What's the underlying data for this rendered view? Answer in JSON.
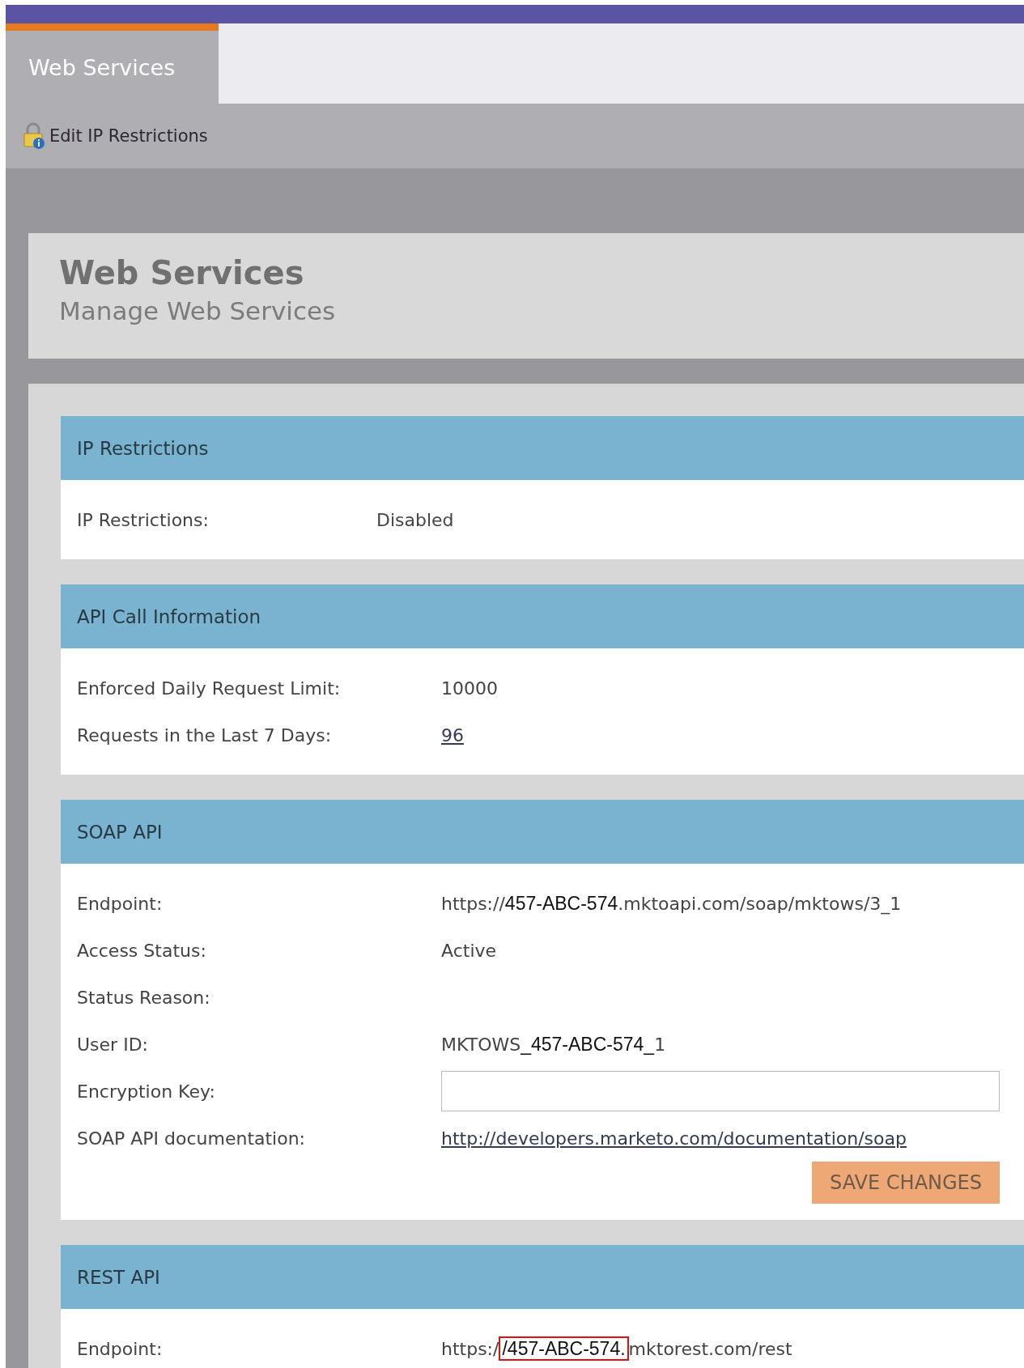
{
  "tabs": [
    {
      "label": "Web Services",
      "selected": true
    }
  ],
  "toolbar": [
    {
      "label": "Edit IP Restrictions"
    }
  ],
  "header": {
    "title": "Web Services",
    "subtitle": "Manage Web Services"
  },
  "sections": [
    {
      "title": "IP Restrictions",
      "narrow": true,
      "rows": [
        {
          "label": "IP Restrictions:",
          "kind": "text",
          "value": "Disabled"
        }
      ]
    },
    {
      "title": "API Call Information",
      "rows": [
        {
          "label": "Enforced Daily Request Limit:",
          "kind": "text",
          "value": "10000"
        },
        {
          "label": "Requests in the Last 7 Days:",
          "kind": "link",
          "value": "96"
        }
      ]
    },
    {
      "title": "SOAP API",
      "rows": [
        {
          "label": "Endpoint:",
          "kind": "segments",
          "segments": [
            {
              "text": "https://",
              "inserted": false,
              "highlighted": false
            },
            {
              "text": "457-ABC-574",
              "inserted": true,
              "highlighted": false
            },
            {
              "text": ".mktoapi.com/soap/mktows/3_1",
              "inserted": false,
              "highlighted": false
            }
          ]
        },
        {
          "label": "Access Status:",
          "kind": "text",
          "value": "Active"
        },
        {
          "label": "Status Reason:",
          "kind": "text"
        },
        {
          "label": "User ID:",
          "kind": "segments",
          "segments": [
            {
              "text": "MKTOWS",
              "inserted": false,
              "highlighted": false
            },
            {
              "text": "_457-ABC-574_",
              "inserted": true,
              "highlighted": false
            },
            {
              "text": "1",
              "inserted": false,
              "highlighted": false
            }
          ]
        },
        {
          "label": "Encryption Key:",
          "kind": "input"
        },
        {
          "label": "SOAP API documentation:",
          "kind": "link",
          "value": "http://developers.marketo.com/documentation/soap"
        }
      ],
      "button": {
        "label": "SAVE CHANGES",
        "disabled": true
      }
    },
    {
      "title": "REST API",
      "rows": [
        {
          "label": "Endpoint:",
          "kind": "segments",
          "segments": [
            {
              "text": "https:/",
              "inserted": false,
              "highlighted": false
            },
            {
              "text": "/457-ABC-574.",
              "inserted": true,
              "highlighted": true
            },
            {
              "text": "mktorest.com/rest",
              "inserted": false,
              "highlighted": false
            }
          ]
        }
      ]
    }
  ]
}
